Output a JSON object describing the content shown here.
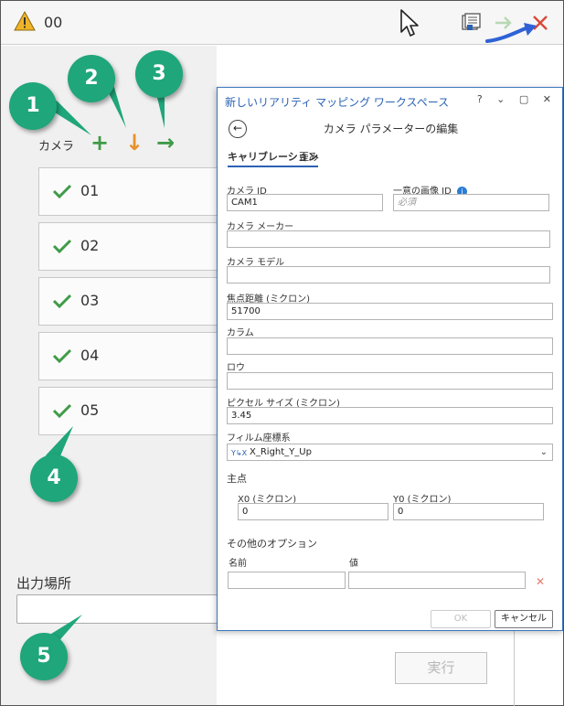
{
  "toolbar": {
    "title": "00",
    "icons": [
      "warning-icon",
      "pointer-icon",
      "properties-icon",
      "next-icon",
      "close-icon"
    ]
  },
  "left_panel": {
    "camera_label": "カメラ",
    "cameras": [
      {
        "label": "01"
      },
      {
        "label": "02"
      },
      {
        "label": "03"
      },
      {
        "label": "04"
      },
      {
        "label": "05"
      }
    ],
    "output_label": "出力場所",
    "output_value": "",
    "run_label": "実行"
  },
  "callouts": [
    "1",
    "2",
    "3",
    "4",
    "5"
  ],
  "dialog": {
    "title": "新しいリアリティ マッピング ワークスペース",
    "controls": "? ⌄ ▢ ✕",
    "subtitle": "カメラ パラメーターの編集",
    "tabs": [
      "キャリブレーション",
      "歪み"
    ],
    "camera_id_label": "カメラ ID",
    "camera_id_value": "CAM1",
    "unique_id_label": "一意の画像 ID",
    "unique_id_placeholder": "必須",
    "maker_label": "カメラ メーカー",
    "maker_value": "",
    "model_label": "カメラ モデル",
    "model_value": "",
    "focal_label": "焦点距離 (ミクロン)",
    "focal_value": "51700",
    "columns_label": "カラム",
    "columns_value": "",
    "rows_label": "ロウ",
    "rows_value": "",
    "pixel_label": "ピクセル サイズ (ミクロン)",
    "pixel_value": "3.45",
    "film_label": "フィルム座標系",
    "film_value": "X_Right_Y_Up",
    "principal_label": "主点",
    "x0_label": "X0 (ミクロン)",
    "x0_value": "0",
    "y0_label": "Y0 (ミクロン)",
    "y0_value": "0",
    "options_label": "その他のオプション",
    "name_label": "名前",
    "value_label": "値",
    "ok_label": "OK",
    "cancel_label": "キャンセル"
  },
  "colors": {
    "callout": "#1fa67a",
    "add": "#3f9b48",
    "download": "#e8922b",
    "close": "#d9493a",
    "dialog_accent": "#2a62b4"
  }
}
